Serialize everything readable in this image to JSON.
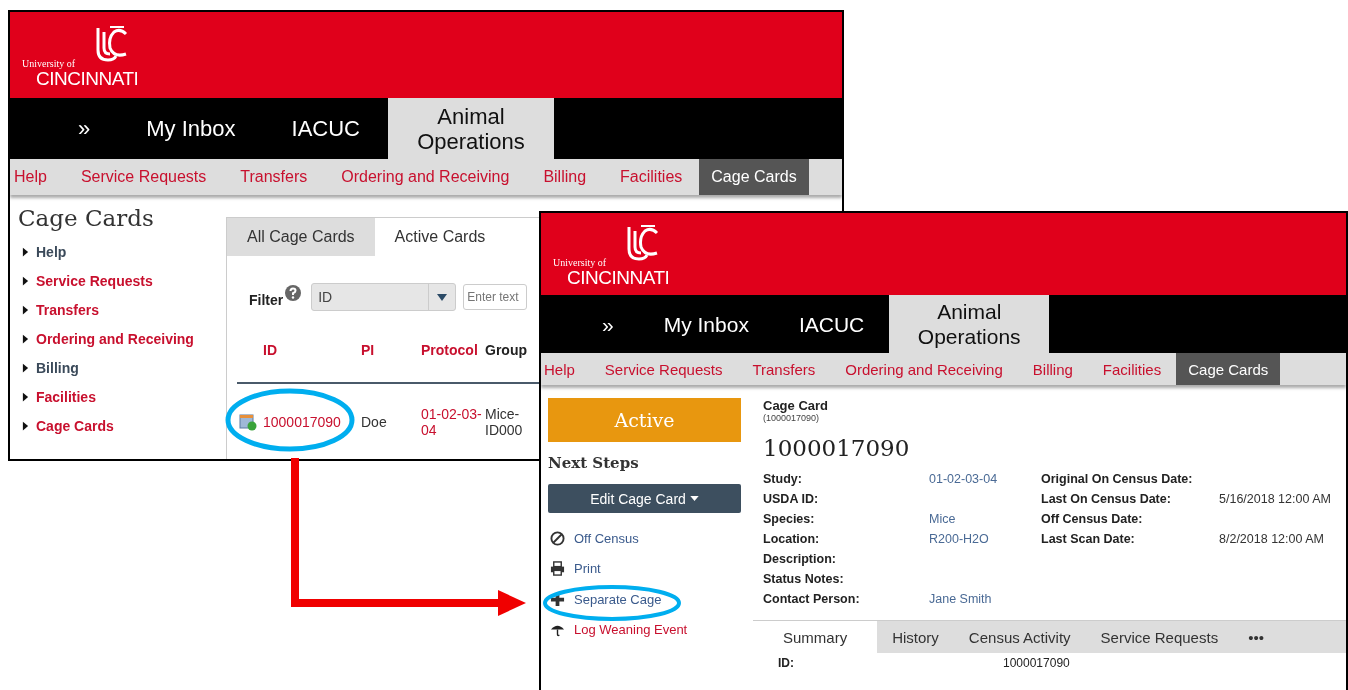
{
  "windows": [
    {
      "kind": "list",
      "logo": {
        "line1": "University of",
        "line2": "CINCINNATI"
      },
      "top_nav": [
        {
          "label": "»",
          "selected": false
        },
        {
          "label": "My Inbox",
          "selected": false
        },
        {
          "label": "IACUC",
          "selected": false
        },
        {
          "label": "Animal Operations",
          "selected": true
        }
      ],
      "sub_nav": [
        {
          "label": "Help",
          "selected": false
        },
        {
          "label": "Service Requests",
          "selected": false
        },
        {
          "label": "Transfers",
          "selected": false
        },
        {
          "label": "Ordering and Receiving",
          "selected": false
        },
        {
          "label": "Billing",
          "selected": false
        },
        {
          "label": "Facilities",
          "selected": false
        },
        {
          "label": "Cage Cards",
          "selected": true
        }
      ],
      "page_title": "Cage Cards",
      "sidebar": [
        {
          "label": "Help",
          "color": "#3b4a5a"
        },
        {
          "label": "Service Requests",
          "color": "#c8102e"
        },
        {
          "label": "Transfers",
          "color": "#c8102e"
        },
        {
          "label": "Ordering and Receiving",
          "color": "#c8102e"
        },
        {
          "label": "Billing",
          "color": "#3b4a5a"
        },
        {
          "label": "Facilities",
          "color": "#c8102e"
        },
        {
          "label": "Cage Cards",
          "color": "#c8102e"
        }
      ],
      "tabs": [
        {
          "label": "All Cage Cards",
          "selected": false
        },
        {
          "label": "Active Cards",
          "selected": true
        }
      ],
      "filter": {
        "label": "Filter",
        "select_value": "ID",
        "placeholder": "Enter text"
      },
      "table": {
        "columns": [
          {
            "label": "ID",
            "color": "#c8102e"
          },
          {
            "label": "PI",
            "color": "#c8102e"
          },
          {
            "label": "Protocol",
            "color": "#c8102e"
          },
          {
            "label": "Group",
            "color": "#222222"
          }
        ],
        "rows": [
          {
            "id": "1000017090",
            "pi": "Doe",
            "protocol": "01-02-03-04",
            "group": "Mice-ID000",
            "highlighted": true
          }
        ]
      }
    },
    {
      "kind": "detail",
      "logo": {
        "line1": "University of",
        "line2": "CINCINNATI"
      },
      "top_nav": [
        {
          "label": "»",
          "selected": false
        },
        {
          "label": "My Inbox",
          "selected": false
        },
        {
          "label": "IACUC",
          "selected": false
        },
        {
          "label": "Animal Operations",
          "selected": true
        }
      ],
      "sub_nav": [
        {
          "label": "Help",
          "selected": false
        },
        {
          "label": "Service Requests",
          "selected": false
        },
        {
          "label": "Transfers",
          "selected": false
        },
        {
          "label": "Ordering and Receiving",
          "selected": false
        },
        {
          "label": "Billing",
          "selected": false
        },
        {
          "label": "Facilities",
          "selected": false
        },
        {
          "label": "Cage Cards",
          "selected": true
        }
      ],
      "status": "Active",
      "next_steps_title": "Next Steps",
      "edit_button": "Edit Cage Card",
      "actions": [
        {
          "kind": "ban",
          "label": "Off Census",
          "color": "#3a5a8c",
          "highlighted": false
        },
        {
          "kind": "print",
          "label": "Print",
          "color": "#3a5a8c",
          "highlighted": false
        },
        {
          "kind": "plus",
          "label": "Separate Cage",
          "color": "#3a5a8c",
          "highlighted": true
        },
        {
          "kind": "weaning",
          "label": "Log Weaning Event",
          "color": "#c8102e",
          "highlighted": false
        }
      ],
      "card_label": "Cage Card",
      "card_sub": "(1000017090)",
      "card_id": "1000017090",
      "fields_left": [
        {
          "label": "Study:",
          "value": "01-02-03-04"
        },
        {
          "label": "USDA ID:"
        },
        {
          "label": "Species:",
          "value": "Mice"
        },
        {
          "label": "Location:",
          "value": "R200-H2O"
        },
        {
          "label": "Description:"
        },
        {
          "label": "Status Notes:"
        },
        {
          "label": "Contact Person:",
          "value": "Jane Smith"
        }
      ],
      "fields_right": [
        {
          "label": "Original On Census Date:"
        },
        {
          "label": "Last On Census Date:",
          "value": "5/16/2018 12:00 AM"
        },
        {
          "label": "Off Census Date:"
        },
        {
          "label": "Last Scan Date:",
          "value": "8/2/2018 12:00 AM"
        }
      ],
      "tabs": [
        {
          "label": "Summary",
          "selected": true
        },
        {
          "label": "History",
          "selected": false
        },
        {
          "label": "Census Activity",
          "selected": false
        },
        {
          "label": "Service Requests",
          "selected": false
        },
        {
          "label": "•••",
          "selected": false
        }
      ],
      "summary_fields": [
        {
          "label": "ID:",
          "value": "1000017090"
        }
      ]
    }
  ]
}
